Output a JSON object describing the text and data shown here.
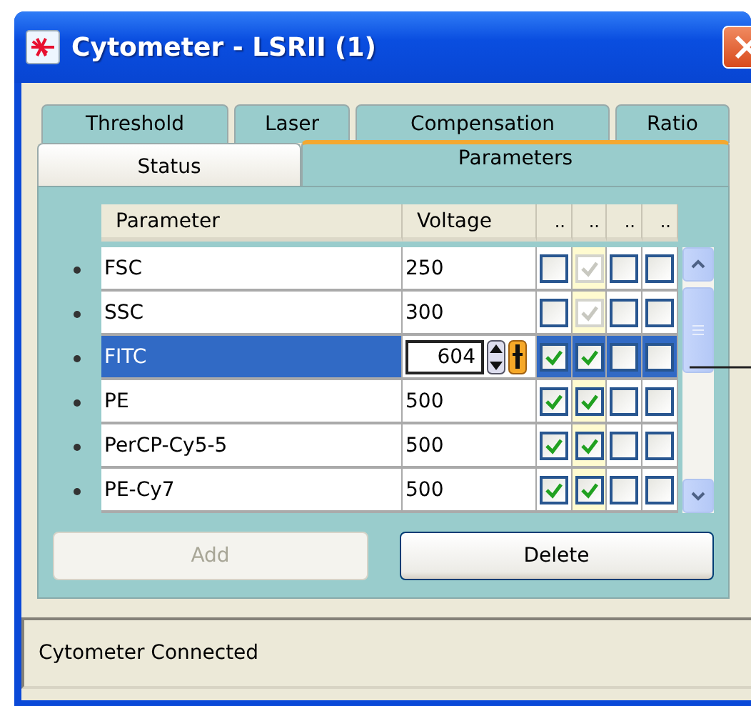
{
  "window": {
    "title": "Cytometer - LSRII (1)"
  },
  "tab_rows": [
    [
      {
        "label": "Threshold",
        "selected": false
      },
      {
        "label": "Laser",
        "selected": false
      },
      {
        "label": "Compensation",
        "selected": false
      },
      {
        "label": "Ratio",
        "selected": false
      }
    ],
    [
      {
        "label": "Status",
        "selected": false
      },
      {
        "label": "Parameters",
        "selected": true
      }
    ]
  ],
  "grid": {
    "columns": [
      {
        "label": "Parameter",
        "highlighted": false
      },
      {
        "label": "Voltage",
        "highlighted": false
      },
      {
        "label": "..",
        "highlighted": false
      },
      {
        "label": "..",
        "highlighted": true
      },
      {
        "label": "..",
        "highlighted": false
      },
      {
        "label": "..",
        "highlighted": false
      }
    ],
    "rows": [
      {
        "parameter": "FSC",
        "voltage": "250",
        "selected": false,
        "editing": false,
        "checks": [
          {
            "checked": false,
            "disabled": false
          },
          {
            "checked": true,
            "disabled": true
          },
          {
            "checked": false,
            "disabled": false
          },
          {
            "checked": false,
            "disabled": false
          }
        ]
      },
      {
        "parameter": "SSC",
        "voltage": "300",
        "selected": false,
        "editing": false,
        "checks": [
          {
            "checked": false,
            "disabled": false
          },
          {
            "checked": true,
            "disabled": true
          },
          {
            "checked": false,
            "disabled": false
          },
          {
            "checked": false,
            "disabled": false
          }
        ]
      },
      {
        "parameter": "FITC",
        "voltage": "604",
        "selected": true,
        "editing": true,
        "checks": [
          {
            "checked": true,
            "disabled": false
          },
          {
            "checked": true,
            "disabled": false
          },
          {
            "checked": false,
            "disabled": false
          },
          {
            "checked": false,
            "disabled": false
          }
        ]
      },
      {
        "parameter": "PE",
        "voltage": "500",
        "selected": false,
        "editing": false,
        "checks": [
          {
            "checked": true,
            "disabled": false
          },
          {
            "checked": true,
            "disabled": false
          },
          {
            "checked": false,
            "disabled": false
          },
          {
            "checked": false,
            "disabled": false
          }
        ]
      },
      {
        "parameter": "PerCP-Cy5-5",
        "voltage": "500",
        "selected": false,
        "editing": false,
        "checks": [
          {
            "checked": true,
            "disabled": false
          },
          {
            "checked": true,
            "disabled": false
          },
          {
            "checked": false,
            "disabled": false
          },
          {
            "checked": false,
            "disabled": false
          }
        ]
      },
      {
        "parameter": "PE-Cy7",
        "voltage": "500",
        "selected": false,
        "editing": false,
        "checks": [
          {
            "checked": true,
            "disabled": false
          },
          {
            "checked": true,
            "disabled": false
          },
          {
            "checked": false,
            "disabled": false
          },
          {
            "checked": false,
            "disabled": false
          }
        ]
      }
    ]
  },
  "buttons": [
    {
      "label": "Add",
      "disabled": true
    },
    {
      "label": "Delete",
      "disabled": false
    }
  ],
  "status_bar": "Cytometer Connected"
}
